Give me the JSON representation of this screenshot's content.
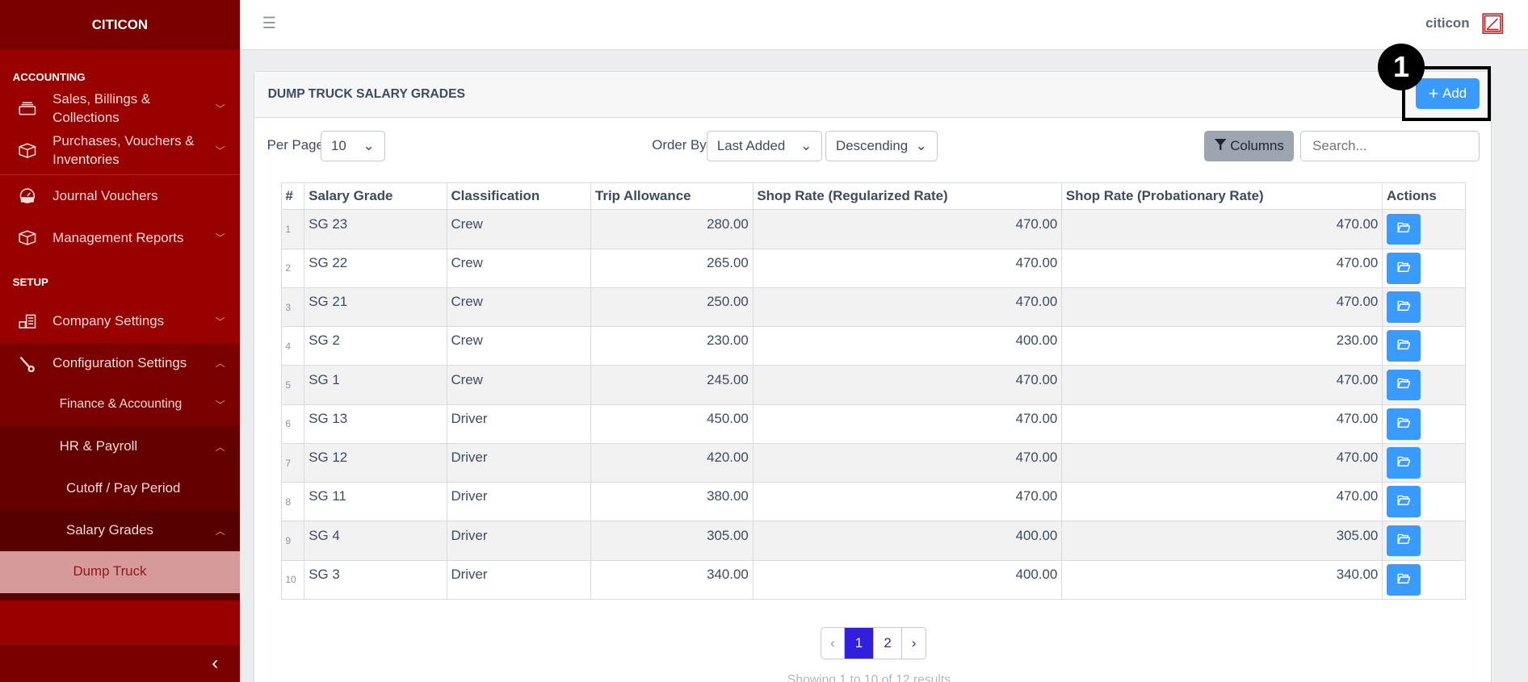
{
  "brand": "CITICON",
  "sidebar": {
    "sections": [
      {
        "title": "ACCOUNTING"
      },
      {
        "title": "SETUP"
      }
    ],
    "items": [
      {
        "label": "Sales, Billings & Collections",
        "icon": "inbox-icon"
      },
      {
        "label": "Purchases, Vouchers & Inventories",
        "icon": "box-icon"
      },
      {
        "label": "Journal Vouchers",
        "icon": "speedometer-icon"
      },
      {
        "label": "Management Reports",
        "icon": "box-icon"
      },
      {
        "label": "Company Settings",
        "icon": "building-icon"
      },
      {
        "label": "Configuration Settings",
        "icon": "wrench-icon"
      },
      {
        "label": "Finance & Accounting"
      },
      {
        "label": "HR & Payroll"
      },
      {
        "label": "Cutoff / Pay Period"
      },
      {
        "label": "Salary Grades"
      },
      {
        "label": "Dump Truck"
      }
    ],
    "collapse": "‹"
  },
  "header": {
    "user": "citicon",
    "menu_icon": "☰"
  },
  "card": {
    "title": "DUMP TRUCK SALARY GRADES",
    "add_label": "Add",
    "annotation": "1"
  },
  "controls": {
    "per_page_label": "Per Page",
    "per_page": "10",
    "order_by_label": "Order By",
    "order_by": "Last Added",
    "direction": "Descending",
    "columns_label": "Columns",
    "search_placeholder": "Search..."
  },
  "table": {
    "headers": [
      "#",
      "Salary Grade",
      "Classification",
      "Trip Allowance",
      "Shop Rate (Regularized Rate)",
      "Shop Rate (Probationary Rate)",
      "Actions"
    ],
    "rows": [
      [
        "1",
        "SG 23",
        "Crew",
        "280.00",
        "470.00",
        "470.00"
      ],
      [
        "2",
        "SG 22",
        "Crew",
        "265.00",
        "470.00",
        "470.00"
      ],
      [
        "3",
        "SG 21",
        "Crew",
        "250.00",
        "470.00",
        "470.00"
      ],
      [
        "4",
        "SG 2",
        "Crew",
        "230.00",
        "400.00",
        "230.00"
      ],
      [
        "5",
        "SG 1",
        "Crew",
        "245.00",
        "470.00",
        "470.00"
      ],
      [
        "6",
        "SG 13",
        "Driver",
        "450.00",
        "470.00",
        "470.00"
      ],
      [
        "7",
        "SG 12",
        "Driver",
        "420.00",
        "470.00",
        "470.00"
      ],
      [
        "8",
        "SG 11",
        "Driver",
        "380.00",
        "470.00",
        "470.00"
      ],
      [
        "9",
        "SG 4",
        "Driver",
        "305.00",
        "400.00",
        "305.00"
      ],
      [
        "10",
        "SG 3",
        "Driver",
        "340.00",
        "400.00",
        "340.00"
      ]
    ]
  },
  "pagination": {
    "prev": "‹",
    "pages": [
      "1",
      "2"
    ],
    "next": "›",
    "current": "1",
    "summary": "Showing 1 to 10 of 12 results"
  }
}
